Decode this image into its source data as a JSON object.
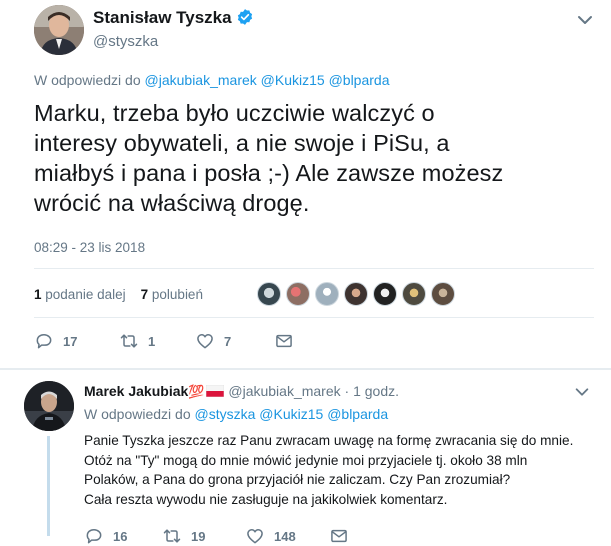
{
  "main_tweet": {
    "display_name": "Stanisław Tyszka",
    "handle": "@styszka",
    "reply_prefix": "W odpowiedzi do",
    "reply_mentions": "@jakubiak_marek @Kukiz15 @blparda",
    "text_lines": [
      "Marku, trzeba było uczciwie walczyć o",
      "interesy obywateli, a nie swoje i PiSu, a",
      "miałbyś i pana i posła ;-) Ale zawsze możesz",
      "wrócić na właściwą drogę."
    ],
    "timestamp": "08:29 - 23 lis 2018",
    "retweets_count": "1",
    "retweets_label": "podanie dalej",
    "likes_count": "7",
    "likes_label": "polubień",
    "actions": {
      "replies": "17",
      "retweets": "1",
      "likes": "7"
    }
  },
  "reply_tweet": {
    "display_name": "Marek Jakubiak",
    "name_emoji": "💯",
    "handle": "@jakubiak_marek",
    "separator": "·",
    "time": "1 godz.",
    "reply_prefix": "W odpowiedzi do",
    "reply_mentions": "@styszka @Kukiz15 @blparda",
    "text_lines": [
      "Panie Tyszka jeszcze raz Panu zwracam uwagę na formę zwracania się do mnie.",
      "Otóż na \"Ty\" mogą do mnie mówić jedynie moi przyjaciele tj. około 38 mln",
      "Polaków, a Pana do grona przyjaciół nie zaliczam. Czy Pan zrozumiał?",
      "Cała reszta wywodu nie zasługuje na jakikolwiek komentarz."
    ],
    "actions": {
      "replies": "16",
      "retweets": "19",
      "likes": "148"
    }
  },
  "colors": {
    "link": "#1b95e0",
    "muted": "#657786",
    "text": "#14171a",
    "divider": "#e6ecf0",
    "verified": "#1da1f2"
  },
  "icons": [
    "verified-badge-icon",
    "chevron-down-icon",
    "reply-icon",
    "retweet-icon",
    "like-icon",
    "direct-message-icon",
    "polish-flag-icon"
  ]
}
